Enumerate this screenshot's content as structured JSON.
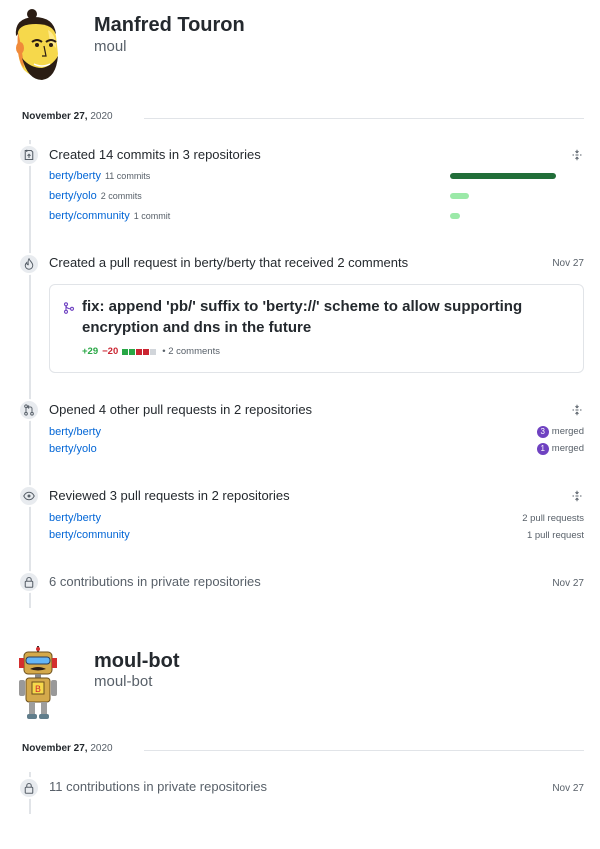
{
  "users": [
    {
      "name": "Manfred Touron",
      "login": "moul",
      "date": {
        "day": "November 27,",
        "year": "2020"
      },
      "commits": {
        "title": "Created 14 commits in 3 repositories",
        "repos": [
          {
            "name": "berty/berty",
            "count": "11 commits",
            "fraction": 0.79,
            "color": "#216e39"
          },
          {
            "name": "berty/yolo",
            "count": "2 commits",
            "fraction": 0.14,
            "color": "#9be9a8"
          },
          {
            "name": "berty/community",
            "count": "1 commit",
            "fraction": 0.07,
            "color": "#9be9a8"
          }
        ]
      },
      "pr_created": {
        "title": "Created a pull request in berty/berty that received 2 comments",
        "date": "Nov 27",
        "pr_title": "fix: append 'pb/' suffix to 'berty://' scheme to allow supporting encryption and dns in the future",
        "additions": "+29",
        "deletions": "−20",
        "comments": "• 2 comments",
        "diffstat_colors": [
          "#28a745",
          "#28a745",
          "#cb2431",
          "#cb2431",
          "#d1d5da"
        ]
      },
      "prs_opened": {
        "title": "Opened 4 other pull requests in 2 repositories",
        "repos": [
          {
            "name": "berty/berty",
            "merged_count": "3",
            "merged_label": "merged"
          },
          {
            "name": "berty/yolo",
            "merged_count": "1",
            "merged_label": "merged"
          }
        ]
      },
      "reviewed": {
        "title": "Reviewed 3 pull requests in 2 repositories",
        "repos": [
          {
            "name": "berty/berty",
            "note": "2 pull requests"
          },
          {
            "name": "berty/community",
            "note": "1 pull request"
          }
        ]
      },
      "private": {
        "title": "6 contributions in private repositories",
        "date": "Nov 27"
      }
    },
    {
      "name": "moul-bot",
      "login": "moul-bot",
      "date": {
        "day": "November 27,",
        "year": "2020"
      },
      "private": {
        "title": "11 contributions in private repositories",
        "date": "Nov 27"
      }
    }
  ],
  "icons": {
    "commit": "repo-push-icon",
    "pr_created": "flame-icon",
    "prs_opened": "git-pull-request-icon",
    "reviewed": "eye-icon",
    "private": "lock-icon",
    "fold": "fold-icon",
    "merge": "git-merge-icon"
  }
}
